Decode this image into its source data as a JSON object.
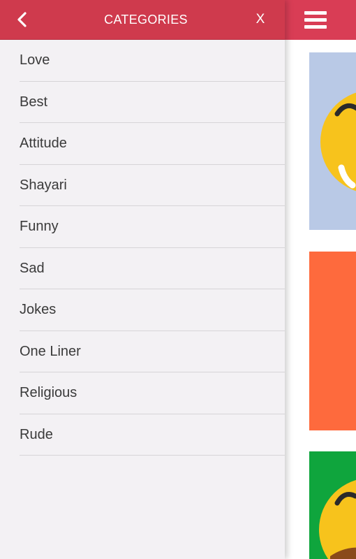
{
  "drawer": {
    "title": "CATEGORIES",
    "close_label": "X",
    "back_icon": "chevron-left-icon",
    "header_color": "#cf3a4d",
    "items": [
      {
        "label": "Love"
      },
      {
        "label": "Best"
      },
      {
        "label": "Attitude"
      },
      {
        "label": "Shayari"
      },
      {
        "label": "Funny"
      },
      {
        "label": "Sad"
      },
      {
        "label": "Jokes"
      },
      {
        "label": "One Liner"
      },
      {
        "label": "Religious"
      },
      {
        "label": "Rude"
      }
    ]
  },
  "main": {
    "menu_icon": "hamburger-menu-icon",
    "topbar_color": "#d93d55",
    "cards": [
      {
        "background": "#b9c9e6",
        "image": "emoji-face"
      },
      {
        "background": "#fe6a3d",
        "image": "solid-color"
      },
      {
        "background": "#0fa53d",
        "image": "emoji-face"
      }
    ]
  }
}
